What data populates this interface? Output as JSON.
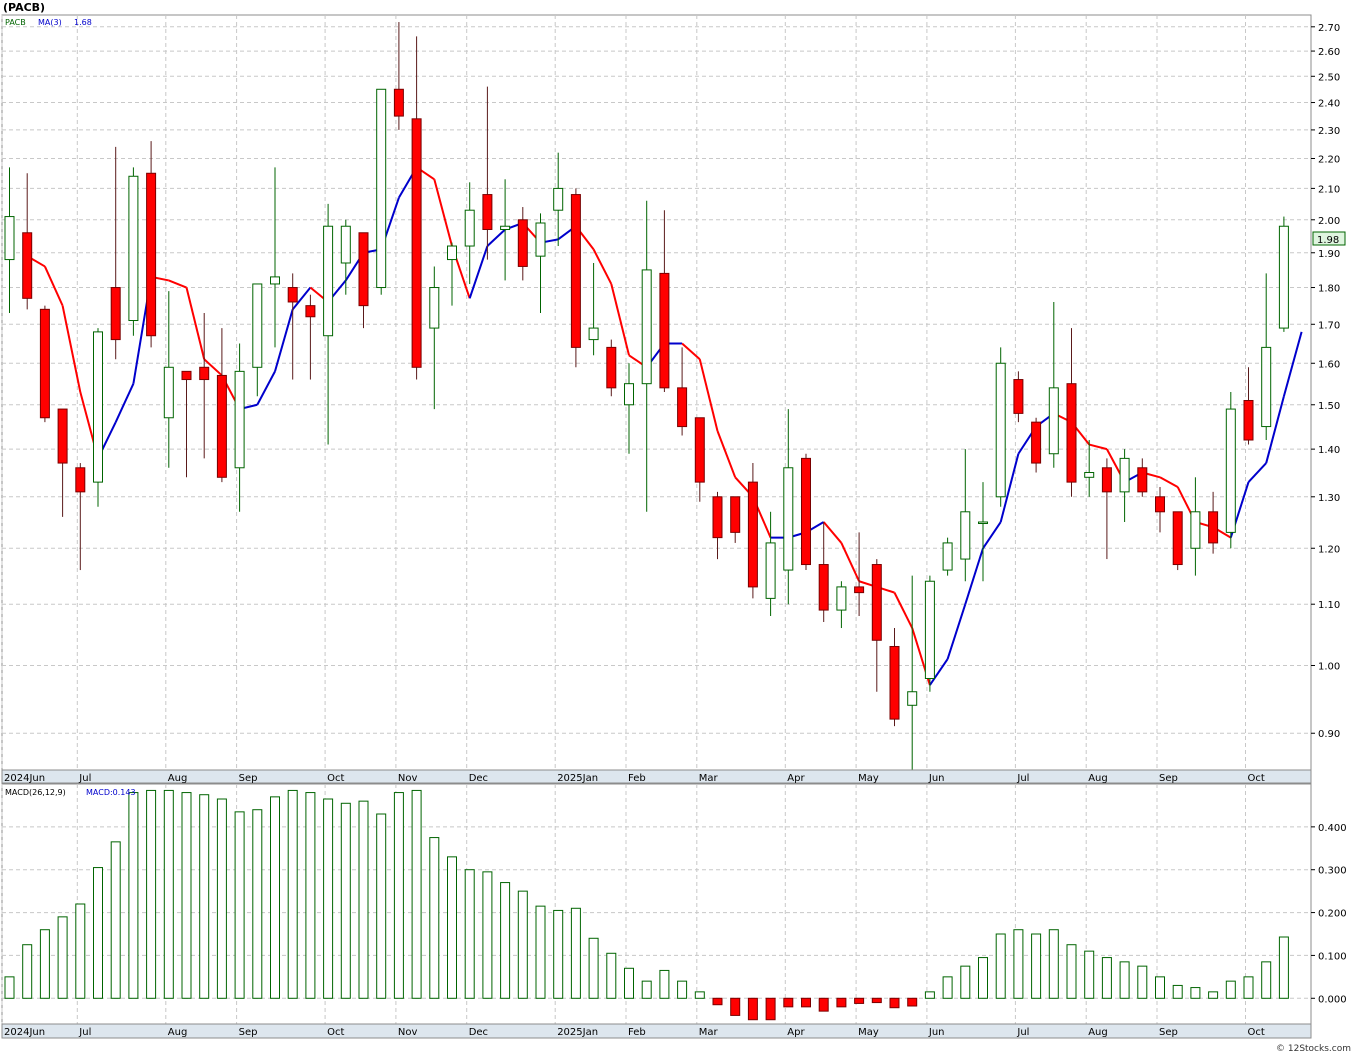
{
  "header": {
    "ticker_title": "(PACB)",
    "price_label": "1.98",
    "watermark": "© 12Stocks.com"
  },
  "price_legend": {
    "series": "PACB",
    "ma_label": "MA(3)",
    "ma_value": "1.68"
  },
  "macd_legend": {
    "params": "MACD(26,12,9)",
    "value_label": "MACD:0.143"
  },
  "colors": {
    "up_candle_stroke": "#006400",
    "down_candle_fill": "#ff0000",
    "ma_down": "#ff0000",
    "ma_up": "#0000cc",
    "grid": "#c8c8c8",
    "axis_band": "#dde6ee",
    "macd_bar": "#006400"
  },
  "chart_data": [
    {
      "type": "candlestick",
      "title": "(PACB)",
      "y_axis": {
        "scale": "log",
        "range": [
          0.85,
          2.75
        ],
        "ticks": [
          "2.70",
          "2.60",
          "2.50",
          "2.40",
          "2.30",
          "2.20",
          "2.10",
          "2.00",
          "1.90",
          "1.80",
          "1.70",
          "1.60",
          "1.50",
          "1.40",
          "1.30",
          "1.20",
          "1.10",
          "1.00",
          "0.90"
        ]
      },
      "x_axis": {
        "labels": [
          "2024Jun",
          "Jul",
          "Aug",
          "Sep",
          "Oct",
          "Nov",
          "Dec",
          "2025Jan",
          "Feb",
          "Mar",
          "Apr",
          "May",
          "Jun",
          "Jul",
          "Aug",
          "Sep",
          "Oct"
        ],
        "label_week_index": [
          0,
          4,
          9,
          13,
          18,
          22,
          26,
          31,
          35,
          39,
          44,
          48,
          52,
          57,
          61,
          65,
          70
        ]
      },
      "grid": true,
      "last_price": 1.98,
      "candles": [
        {
          "o": 1.88,
          "h": 2.17,
          "l": 1.73,
          "c": 2.01
        },
        {
          "o": 1.96,
          "h": 2.15,
          "l": 1.74,
          "c": 1.77
        },
        {
          "o": 1.74,
          "h": 1.75,
          "l": 1.46,
          "c": 1.47
        },
        {
          "o": 1.49,
          "h": 1.49,
          "l": 1.26,
          "c": 1.37
        },
        {
          "o": 1.36,
          "h": 1.37,
          "l": 1.16,
          "c": 1.31
        },
        {
          "o": 1.33,
          "h": 1.69,
          "l": 1.28,
          "c": 1.68
        },
        {
          "o": 1.8,
          "h": 2.24,
          "l": 1.61,
          "c": 1.66
        },
        {
          "o": 1.71,
          "h": 2.17,
          "l": 1.67,
          "c": 2.14
        },
        {
          "o": 2.15,
          "h": 2.26,
          "l": 1.64,
          "c": 1.67
        },
        {
          "o": 1.47,
          "h": 1.79,
          "l": 1.36,
          "c": 1.59
        },
        {
          "o": 1.58,
          "h": 1.58,
          "l": 1.34,
          "c": 1.56
        },
        {
          "o": 1.59,
          "h": 1.73,
          "l": 1.38,
          "c": 1.56
        },
        {
          "o": 1.57,
          "h": 1.69,
          "l": 1.33,
          "c": 1.34
        },
        {
          "o": 1.36,
          "h": 1.65,
          "l": 1.27,
          "c": 1.58
        },
        {
          "o": 1.59,
          "h": 1.81,
          "l": 1.52,
          "c": 1.81
        },
        {
          "o": 1.81,
          "h": 2.17,
          "l": 1.64,
          "c": 1.83
        },
        {
          "o": 1.8,
          "h": 1.84,
          "l": 1.56,
          "c": 1.76
        },
        {
          "o": 1.75,
          "h": 1.78,
          "l": 1.56,
          "c": 1.72
        },
        {
          "o": 1.67,
          "h": 2.05,
          "l": 1.41,
          "c": 1.98
        },
        {
          "o": 1.87,
          "h": 2.0,
          "l": 1.78,
          "c": 1.98
        },
        {
          "o": 1.96,
          "h": 1.96,
          "l": 1.69,
          "c": 1.75
        },
        {
          "o": 1.8,
          "h": 2.16,
          "l": 1.78,
          "c": 2.45
        },
        {
          "o": 2.45,
          "h": 2.72,
          "l": 2.3,
          "c": 2.35
        },
        {
          "o": 2.34,
          "h": 2.66,
          "l": 1.56,
          "c": 1.59
        },
        {
          "o": 1.69,
          "h": 1.86,
          "l": 1.49,
          "c": 1.8
        },
        {
          "o": 1.88,
          "h": 1.93,
          "l": 1.75,
          "c": 1.92
        },
        {
          "o": 1.92,
          "h": 2.12,
          "l": 1.81,
          "c": 2.03
        },
        {
          "o": 2.08,
          "h": 2.46,
          "l": 1.88,
          "c": 1.97
        },
        {
          "o": 1.97,
          "h": 2.13,
          "l": 1.82,
          "c": 1.98
        },
        {
          "o": 2.0,
          "h": 2.04,
          "l": 1.82,
          "c": 1.86
        },
        {
          "o": 1.89,
          "h": 2.02,
          "l": 1.73,
          "c": 1.99
        },
        {
          "o": 2.03,
          "h": 2.22,
          "l": 1.92,
          "c": 2.1
        },
        {
          "o": 2.08,
          "h": 2.1,
          "l": 1.59,
          "c": 1.64
        },
        {
          "o": 1.66,
          "h": 1.87,
          "l": 1.62,
          "c": 1.69
        },
        {
          "o": 1.64,
          "h": 1.66,
          "l": 1.52,
          "c": 1.54
        },
        {
          "o": 1.5,
          "h": 1.6,
          "l": 1.39,
          "c": 1.55
        },
        {
          "o": 1.55,
          "h": 2.06,
          "l": 1.27,
          "c": 1.85
        },
        {
          "o": 1.84,
          "h": 2.03,
          "l": 1.53,
          "c": 1.54
        },
        {
          "o": 1.54,
          "h": 1.64,
          "l": 1.43,
          "c": 1.45
        },
        {
          "o": 1.47,
          "h": 1.47,
          "l": 1.29,
          "c": 1.33
        },
        {
          "o": 1.3,
          "h": 1.31,
          "l": 1.18,
          "c": 1.22
        },
        {
          "o": 1.3,
          "h": 1.3,
          "l": 1.21,
          "c": 1.23
        },
        {
          "o": 1.33,
          "h": 1.37,
          "l": 1.11,
          "c": 1.13
        },
        {
          "o": 1.11,
          "h": 1.27,
          "l": 1.08,
          "c": 1.21
        },
        {
          "o": 1.16,
          "h": 1.49,
          "l": 1.1,
          "c": 1.36
        },
        {
          "o": 1.38,
          "h": 1.39,
          "l": 1.16,
          "c": 1.17
        },
        {
          "o": 1.17,
          "h": 1.25,
          "l": 1.07,
          "c": 1.09
        },
        {
          "o": 1.09,
          "h": 1.14,
          "l": 1.06,
          "c": 1.13
        },
        {
          "o": 1.13,
          "h": 1.23,
          "l": 1.08,
          "c": 1.12
        },
        {
          "o": 1.17,
          "h": 1.18,
          "l": 0.96,
          "c": 1.04
        },
        {
          "o": 1.03,
          "h": 1.06,
          "l": 0.91,
          "c": 0.92
        },
        {
          "o": 0.94,
          "h": 1.15,
          "l": 0.85,
          "c": 0.96
        },
        {
          "o": 0.98,
          "h": 1.15,
          "l": 0.96,
          "c": 1.14
        },
        {
          "o": 1.16,
          "h": 1.22,
          "l": 1.15,
          "c": 1.21
        },
        {
          "o": 1.18,
          "h": 1.4,
          "l": 1.14,
          "c": 1.27
        },
        {
          "o": 1.25,
          "h": 1.33,
          "l": 1.14,
          "c": 1.25
        },
        {
          "o": 1.3,
          "h": 1.64,
          "l": 1.28,
          "c": 1.6
        },
        {
          "o": 1.56,
          "h": 1.58,
          "l": 1.46,
          "c": 1.48
        },
        {
          "o": 1.46,
          "h": 1.47,
          "l": 1.35,
          "c": 1.37
        },
        {
          "o": 1.39,
          "h": 1.76,
          "l": 1.36,
          "c": 1.54
        },
        {
          "o": 1.55,
          "h": 1.69,
          "l": 1.3,
          "c": 1.33
        },
        {
          "o": 1.34,
          "h": 1.42,
          "l": 1.3,
          "c": 1.35
        },
        {
          "o": 1.36,
          "h": 1.38,
          "l": 1.18,
          "c": 1.31
        },
        {
          "o": 1.31,
          "h": 1.4,
          "l": 1.25,
          "c": 1.38
        },
        {
          "o": 1.36,
          "h": 1.38,
          "l": 1.3,
          "c": 1.31
        },
        {
          "o": 1.3,
          "h": 1.32,
          "l": 1.23,
          "c": 1.27
        },
        {
          "o": 1.27,
          "h": 1.27,
          "l": 1.16,
          "c": 1.17
        },
        {
          "o": 1.2,
          "h": 1.34,
          "l": 1.15,
          "c": 1.27
        },
        {
          "o": 1.27,
          "h": 1.31,
          "l": 1.19,
          "c": 1.21
        },
        {
          "o": 1.23,
          "h": 1.53,
          "l": 1.2,
          "c": 1.49
        },
        {
          "o": 1.51,
          "h": 1.59,
          "l": 1.41,
          "c": 1.42
        },
        {
          "o": 1.45,
          "h": 1.84,
          "l": 1.42,
          "c": 1.64
        },
        {
          "o": 1.69,
          "h": 2.01,
          "l": 1.68,
          "c": 1.98
        }
      ],
      "ma3": {
        "label": "MA(3)",
        "values": [
          1.89,
          1.86,
          1.75,
          1.53,
          1.38,
          1.46,
          1.55,
          1.83,
          1.82,
          1.8,
          1.61,
          1.57,
          1.49,
          1.5,
          1.58,
          1.74,
          1.8,
          1.76,
          1.82,
          1.9,
          1.91,
          2.07,
          2.17,
          2.13,
          1.92,
          1.77,
          1.92,
          1.97,
          1.99,
          1.93,
          1.94,
          1.98,
          1.91,
          1.81,
          1.62,
          1.59,
          1.65,
          1.65,
          1.61,
          1.44,
          1.34,
          1.3,
          1.22,
          1.22,
          1.23,
          1.25,
          1.21,
          1.14,
          1.13,
          1.12,
          1.06,
          0.97,
          1.01,
          1.1,
          1.2,
          1.25,
          1.39,
          1.45,
          1.48,
          1.46,
          1.41,
          1.4,
          1.33,
          1.35,
          1.34,
          1.32,
          1.25,
          1.24,
          1.22,
          1.33,
          1.37,
          1.52,
          1.68
        ]
      }
    },
    {
      "type": "bar",
      "title": "MACD(26,12,9)",
      "y_axis": {
        "range": [
          -0.06,
          0.5
        ],
        "ticks": [
          "0.400",
          "0.300",
          "0.200",
          "0.100",
          "0.000"
        ]
      },
      "x_axis": {
        "labels": [
          "2024Jun",
          "Jul",
          "Aug",
          "Sep",
          "Oct",
          "Nov",
          "Dec",
          "2025Jan",
          "Feb",
          "Mar",
          "Apr",
          "May",
          "Jun",
          "Jul",
          "Aug",
          "Sep",
          "Oct"
        ]
      },
      "grid": true,
      "values": [
        0.05,
        0.125,
        0.16,
        0.19,
        0.22,
        0.305,
        0.365,
        0.48,
        0.485,
        0.485,
        0.48,
        0.475,
        0.465,
        0.435,
        0.44,
        0.47,
        0.485,
        0.48,
        0.465,
        0.455,
        0.46,
        0.43,
        0.48,
        0.485,
        0.375,
        0.33,
        0.3,
        0.295,
        0.27,
        0.25,
        0.215,
        0.205,
        0.21,
        0.14,
        0.105,
        0.07,
        0.04,
        0.065,
        0.04,
        0.015,
        -0.015,
        -0.04,
        -0.05,
        -0.05,
        -0.02,
        -0.02,
        -0.03,
        -0.02,
        -0.012,
        -0.01,
        -0.022,
        -0.018,
        0.015,
        0.05,
        0.075,
        0.095,
        0.15,
        0.16,
        0.15,
        0.16,
        0.125,
        0.11,
        0.095,
        0.085,
        0.075,
        0.05,
        0.03,
        0.025,
        0.015,
        0.04,
        0.05,
        0.085,
        0.143
      ]
    }
  ]
}
